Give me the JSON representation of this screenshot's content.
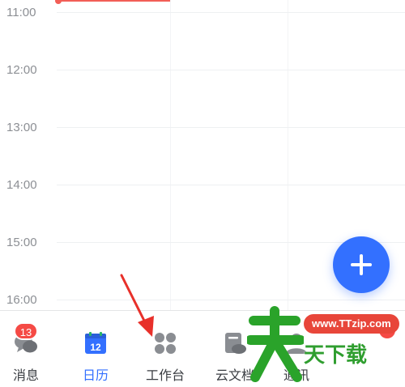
{
  "timeline": {
    "hours": [
      "11:00",
      "12:00",
      "13:00",
      "14:00",
      "15:00",
      "16:00"
    ]
  },
  "fab": {
    "icon": "plus-icon"
  },
  "tabbar": {
    "tabs": [
      {
        "id": "messages",
        "label": "消息",
        "icon": "chat-bubbles-icon",
        "badge": "13"
      },
      {
        "id": "calendar",
        "label": "日历",
        "icon": "calendar-icon",
        "date": "12",
        "active": true
      },
      {
        "id": "workspace",
        "label": "工作台",
        "icon": "grid-apps-icon"
      },
      {
        "id": "docs",
        "label": "云文档",
        "icon": "cloud-doc-icon"
      },
      {
        "id": "contacts",
        "label": "通讯",
        "icon": "contacts-icon"
      }
    ]
  },
  "watermark": {
    "url": "www.TTzip.com",
    "text": "天下载"
  },
  "colors": {
    "accent": "#3370ff",
    "badge": "#f54a45",
    "now_line": "#f25e56",
    "arrow": "#e8302a"
  }
}
